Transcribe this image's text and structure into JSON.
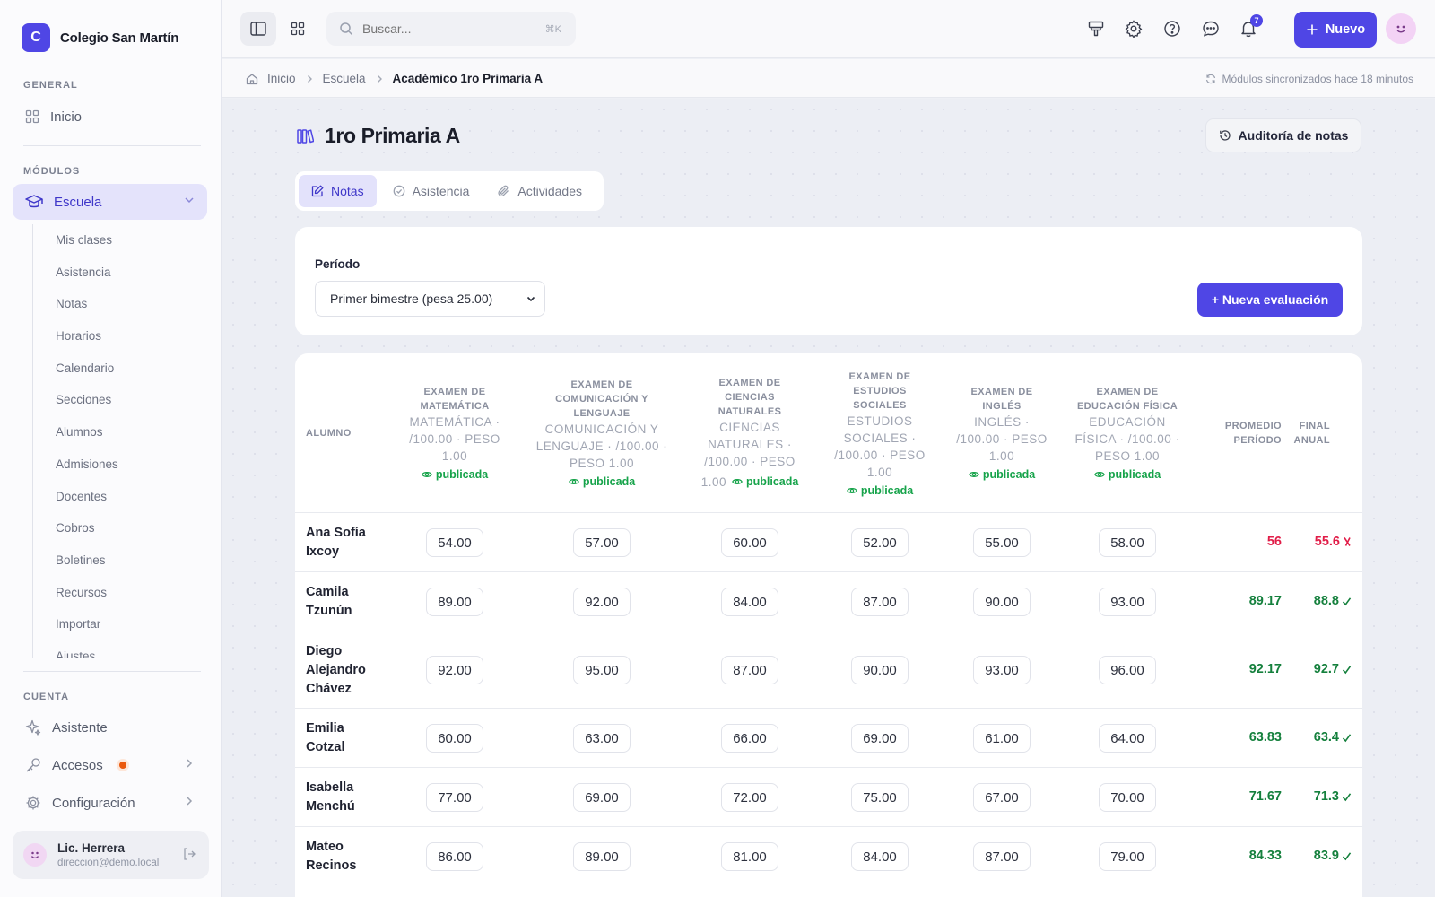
{
  "brand": {
    "initial": "C",
    "name": "Colegio San Martín"
  },
  "sidebar": {
    "general_label": "GENERAL",
    "home_label": "Inicio",
    "modules_label": "MÓDULOS",
    "school_label": "Escuela",
    "school_items": [
      "Mis clases",
      "Asistencia",
      "Notas",
      "Horarios",
      "Calendario",
      "Secciones",
      "Alumnos",
      "Admisiones",
      "Docentes",
      "Cobros",
      "Boletines",
      "Recursos",
      "Importar",
      "Ajustes"
    ],
    "account_label": "CUENTA",
    "assistant_label": "Asistente",
    "access_label": "Accesos",
    "config_label": "Configuración"
  },
  "user": {
    "name": "Lic. Herrera",
    "email": "direccion@demo.local"
  },
  "topbar": {
    "search_placeholder": "Buscar...",
    "search_shortcut": "⌘K",
    "notification_count": "7",
    "new_label": "Nuevo"
  },
  "breadcrumb": {
    "items": [
      "Inicio",
      "Escuela",
      "Académico 1ro Primaria A"
    ],
    "sync_text": "Módulos sincronizados hace 18 minutos"
  },
  "page": {
    "title": "1ro Primaria A",
    "audit_label": "Auditoría de notas",
    "tabs": [
      "Notas",
      "Asistencia",
      "Actividades"
    ]
  },
  "filter": {
    "period_label": "Período",
    "period_value": "Primer bimestre (pesa 25.00)",
    "new_eval_label": "+ Nueva evaluación"
  },
  "table": {
    "student_header": "ALUMNO",
    "average_header": [
      "PROMEDIO",
      "PERÍODO"
    ],
    "final_header": [
      "FINAL",
      "ANUAL"
    ],
    "published_label": "publicada",
    "columns": [
      {
        "title": [
          "EXAMEN DE",
          "MATEMÁTICA"
        ],
        "sub": [
          "MATEMÁTICA ·",
          "/100.00 · PESO",
          "1.00"
        ]
      },
      {
        "title": [
          "EXAMEN DE",
          "COMUNICACIÓN Y",
          "LENGUAJE"
        ],
        "sub": [
          "COMUNICACIÓN Y",
          "LENGUAJE · /100.00 ·",
          "PESO 1.00"
        ]
      },
      {
        "title": [
          "EXAMEN DE",
          "CIENCIAS",
          "NATURALES"
        ],
        "sub": [
          "CIENCIAS",
          "NATURALES ·",
          "/100.00 · PESO"
        ],
        "trail": "1.00"
      },
      {
        "title": [
          "EXAMEN DE",
          "ESTUDIOS",
          "SOCIALES"
        ],
        "sub": [
          "ESTUDIOS",
          "SOCIALES ·",
          "/100.00 · PESO",
          "1.00"
        ]
      },
      {
        "title": [
          "EXAMEN DE",
          "INGLÉS"
        ],
        "sub": [
          "INGLÉS ·",
          "/100.00 · PESO",
          "1.00"
        ]
      },
      {
        "title": [
          "EXAMEN DE",
          "EDUCACIÓN FÍSICA"
        ],
        "sub": [
          "EDUCACIÓN",
          "FÍSICA · /100.00 ·",
          "PESO 1.00"
        ]
      }
    ],
    "rows": [
      {
        "name": [
          "Ana Sofía",
          "Ixcoy"
        ],
        "grades": [
          "54.00",
          "57.00",
          "60.00",
          "52.00",
          "55.00",
          "58.00"
        ],
        "average": "56",
        "final": "55.6",
        "status": "fail"
      },
      {
        "name": [
          "Camila",
          "Tzunún"
        ],
        "grades": [
          "89.00",
          "92.00",
          "84.00",
          "87.00",
          "90.00",
          "93.00"
        ],
        "average": "89.17",
        "final": "88.8",
        "status": "pass"
      },
      {
        "name": [
          "Diego",
          "Alejandro",
          "Chávez"
        ],
        "grades": [
          "92.00",
          "95.00",
          "87.00",
          "90.00",
          "93.00",
          "96.00"
        ],
        "average": "92.17",
        "final": "92.7",
        "status": "pass"
      },
      {
        "name": [
          "Emilia",
          "Cotzal"
        ],
        "grades": [
          "60.00",
          "63.00",
          "66.00",
          "69.00",
          "61.00",
          "64.00"
        ],
        "average": "63.83",
        "final": "63.4",
        "status": "pass"
      },
      {
        "name": [
          "Isabella",
          "Menchú"
        ],
        "grades": [
          "77.00",
          "69.00",
          "72.00",
          "75.00",
          "67.00",
          "70.00"
        ],
        "average": "71.67",
        "final": "71.3",
        "status": "pass"
      },
      {
        "name": [
          "Mateo",
          "Recinos"
        ],
        "grades": [
          "86.00",
          "89.00",
          "81.00",
          "84.00",
          "87.00",
          "79.00"
        ],
        "average": "84.33",
        "final": "83.9",
        "status": "pass"
      }
    ]
  },
  "colors": {
    "accent": "#4f46e5",
    "pass": "#15803d",
    "fail": "#e11d48",
    "published": "#16a34a"
  },
  "icons": [
    "sidebar-toggle-icon",
    "apps-grid-icon",
    "search-icon",
    "megaphone-icon",
    "gear-icon",
    "help-icon",
    "chat-icon",
    "bell-icon",
    "plus-icon",
    "home-icon",
    "chevron-right-icon",
    "sync-icon",
    "books-icon",
    "history-icon",
    "edit-icon",
    "check-circle-icon",
    "paperclip-icon",
    "eye-icon",
    "graduation-cap-icon",
    "sparkle-icon",
    "key-icon",
    "logout-icon"
  ]
}
